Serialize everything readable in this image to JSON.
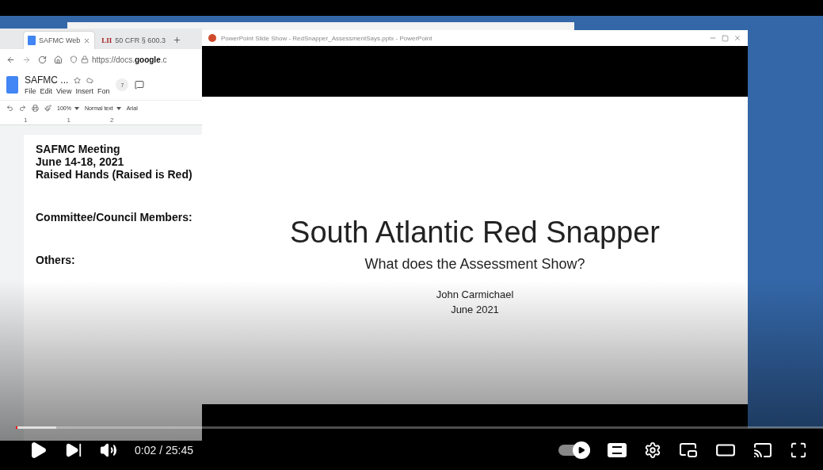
{
  "browser": {
    "tabs": [
      {
        "label": "SAFMC Web",
        "selected": true
      },
      {
        "label": "50 CFR § 600.3",
        "badge": "LII",
        "selected": false
      }
    ],
    "url_prefix": "https://docs.",
    "url_domain": "google",
    "url_suffix": ".c",
    "doc_title": "SAFMC ...",
    "menu": [
      "File",
      "Edit",
      "View",
      "Insert",
      "Fon"
    ],
    "collaborators": "7",
    "zoom": "100%",
    "style": "Normal text",
    "font": "Arial",
    "ruler": [
      "1",
      "1",
      "2"
    ],
    "paragraphs": [
      [
        "SAFMC Meeting",
        "June 14-18, 2021",
        "Raised Hands (Raised is Red)"
      ],
      [
        "Committee/Council Members:"
      ],
      [
        "Others:"
      ]
    ]
  },
  "slideshow": {
    "title": "PowerPoint Slide Show  -  RedSnapper_AssessmentSays.pptx - PowerPoint",
    "slide_title": "South Atlantic Red Snapper",
    "slide_subtitle": "What does the Assessment Show?",
    "author": "John Carmichael",
    "date": "June 2021"
  },
  "player": {
    "time": "0:02 / 25:45",
    "level": 0.002,
    "autoplay": true
  }
}
